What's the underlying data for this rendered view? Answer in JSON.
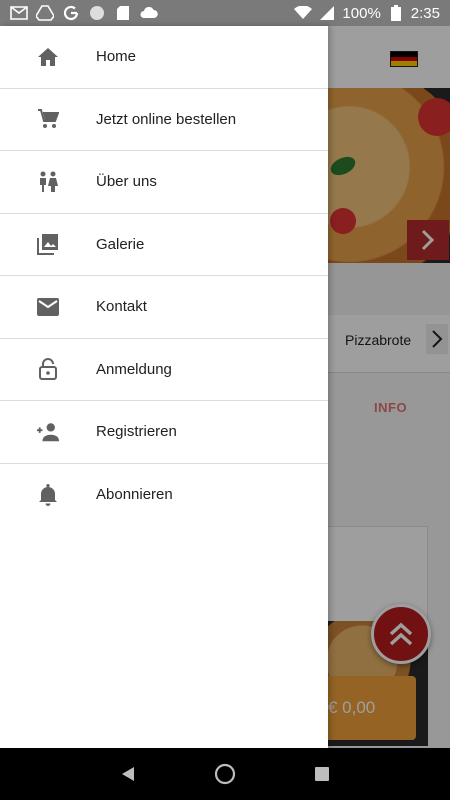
{
  "status_bar": {
    "battery": "100%",
    "time": "2:35",
    "left_icons": [
      "gmail-icon",
      "drive-icon",
      "google-icon",
      "circle-icon",
      "sd-card-icon",
      "cloud-icon"
    ],
    "right_icons": [
      "wifi-icon",
      "signal-icon",
      "battery-icon"
    ]
  },
  "drawer": {
    "items": [
      {
        "label": "Home",
        "icon": "home-icon"
      },
      {
        "label": "Jetzt online bestellen",
        "icon": "cart-icon"
      },
      {
        "label": "Über uns",
        "icon": "people-icon"
      },
      {
        "label": "Galerie",
        "icon": "gallery-icon"
      },
      {
        "label": "Kontakt",
        "icon": "mail-icon"
      },
      {
        "label": "Anmeldung",
        "icon": "lock-icon"
      },
      {
        "label": "Registrieren",
        "icon": "add-person-icon"
      },
      {
        "label": "Abonnieren",
        "icon": "bell-icon"
      }
    ]
  },
  "background": {
    "category_label": "Pizzabrote",
    "info_tab": "INFO",
    "cart_total": "€ 0,00"
  },
  "colors": {
    "accent_red": "#b71c1c",
    "cart_orange": "#f0a23a",
    "icon_gray": "#616161"
  }
}
